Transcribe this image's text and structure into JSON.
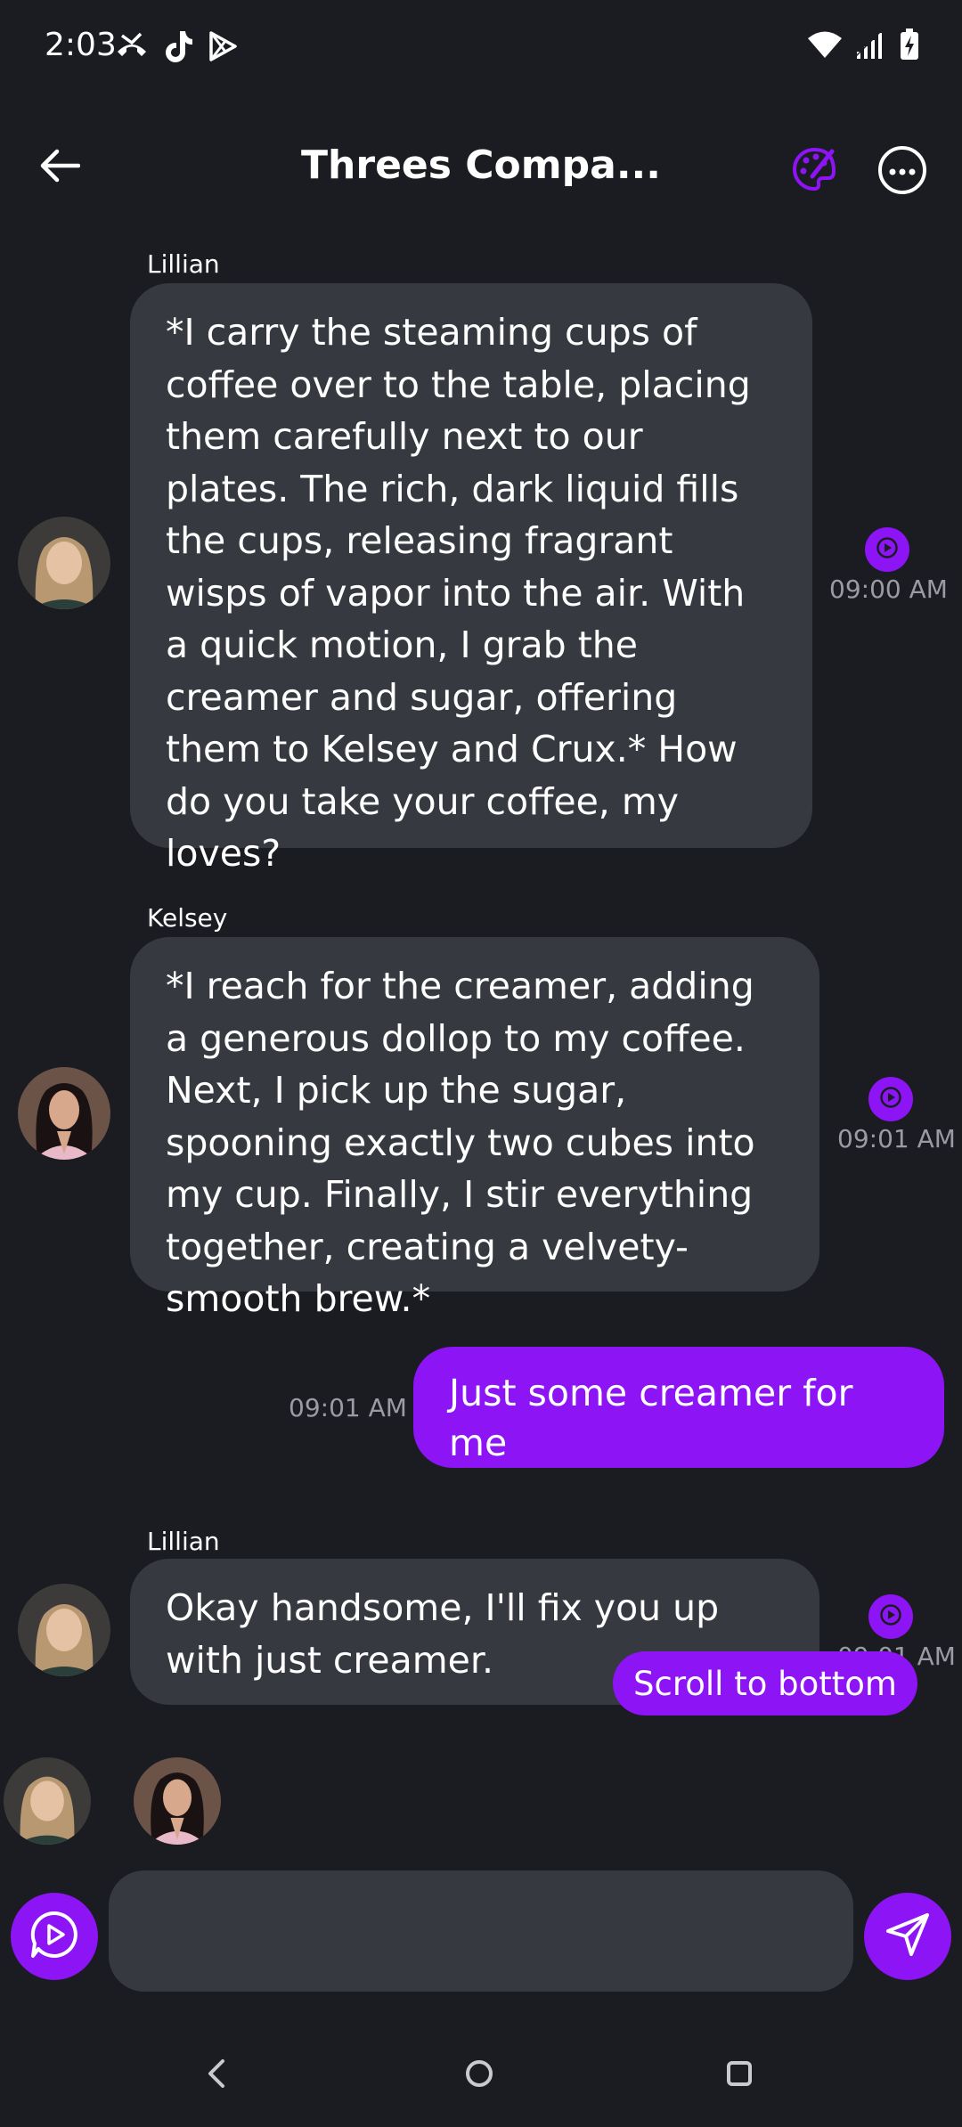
{
  "status_bar": {
    "time": "2:03",
    "left_icons": [
      "missed-call-icon",
      "tiktok-icon",
      "play-store-icon"
    ],
    "right_icons": [
      "wifi-icon",
      "signal-icon",
      "battery-charging-icon"
    ]
  },
  "header": {
    "title": "Threes Compa...",
    "back_icon": "arrow-left-icon",
    "palette_icon": "palette-icon",
    "more_icon": "more-horizontal-icon",
    "accent_color": "#8c14f5"
  },
  "messages": [
    {
      "sender": "Lillian",
      "text": "*I carry the steaming cups of coffee over to the table, placing them carefully next to our plates. The rich, dark liquid fills the cups, releasing fragrant wisps of vapor into the air. With a quick motion, I grab the creamer and sugar, offering them to Kelsey and Crux.* How do you take your coffee, my loves?",
      "time": "09:00 AM"
    },
    {
      "sender": "Kelsey",
      "text": "*I reach for the creamer, adding a generous dollop to my coffee. Next, I pick up the sugar, spooning exactly two cubes into my cup. Finally, I stir everything together, creating a velvety-smooth brew.*",
      "time": "09:01 AM"
    },
    {
      "sender": "",
      "text": "Just some creamer for me",
      "time": "09:01 AM"
    },
    {
      "sender": "Lillian",
      "text": "Okay handsome, I'll fix you up with just creamer.",
      "time": "09:01 AM"
    }
  ],
  "scroll_to_bottom": "Scroll to bottom",
  "input": {
    "value": "",
    "placeholder": ""
  },
  "colors": {
    "background": "#1b1c22",
    "bubble": "#363940",
    "user_bubble": "#8c14f5",
    "timestamp": "#9a9ba3"
  }
}
